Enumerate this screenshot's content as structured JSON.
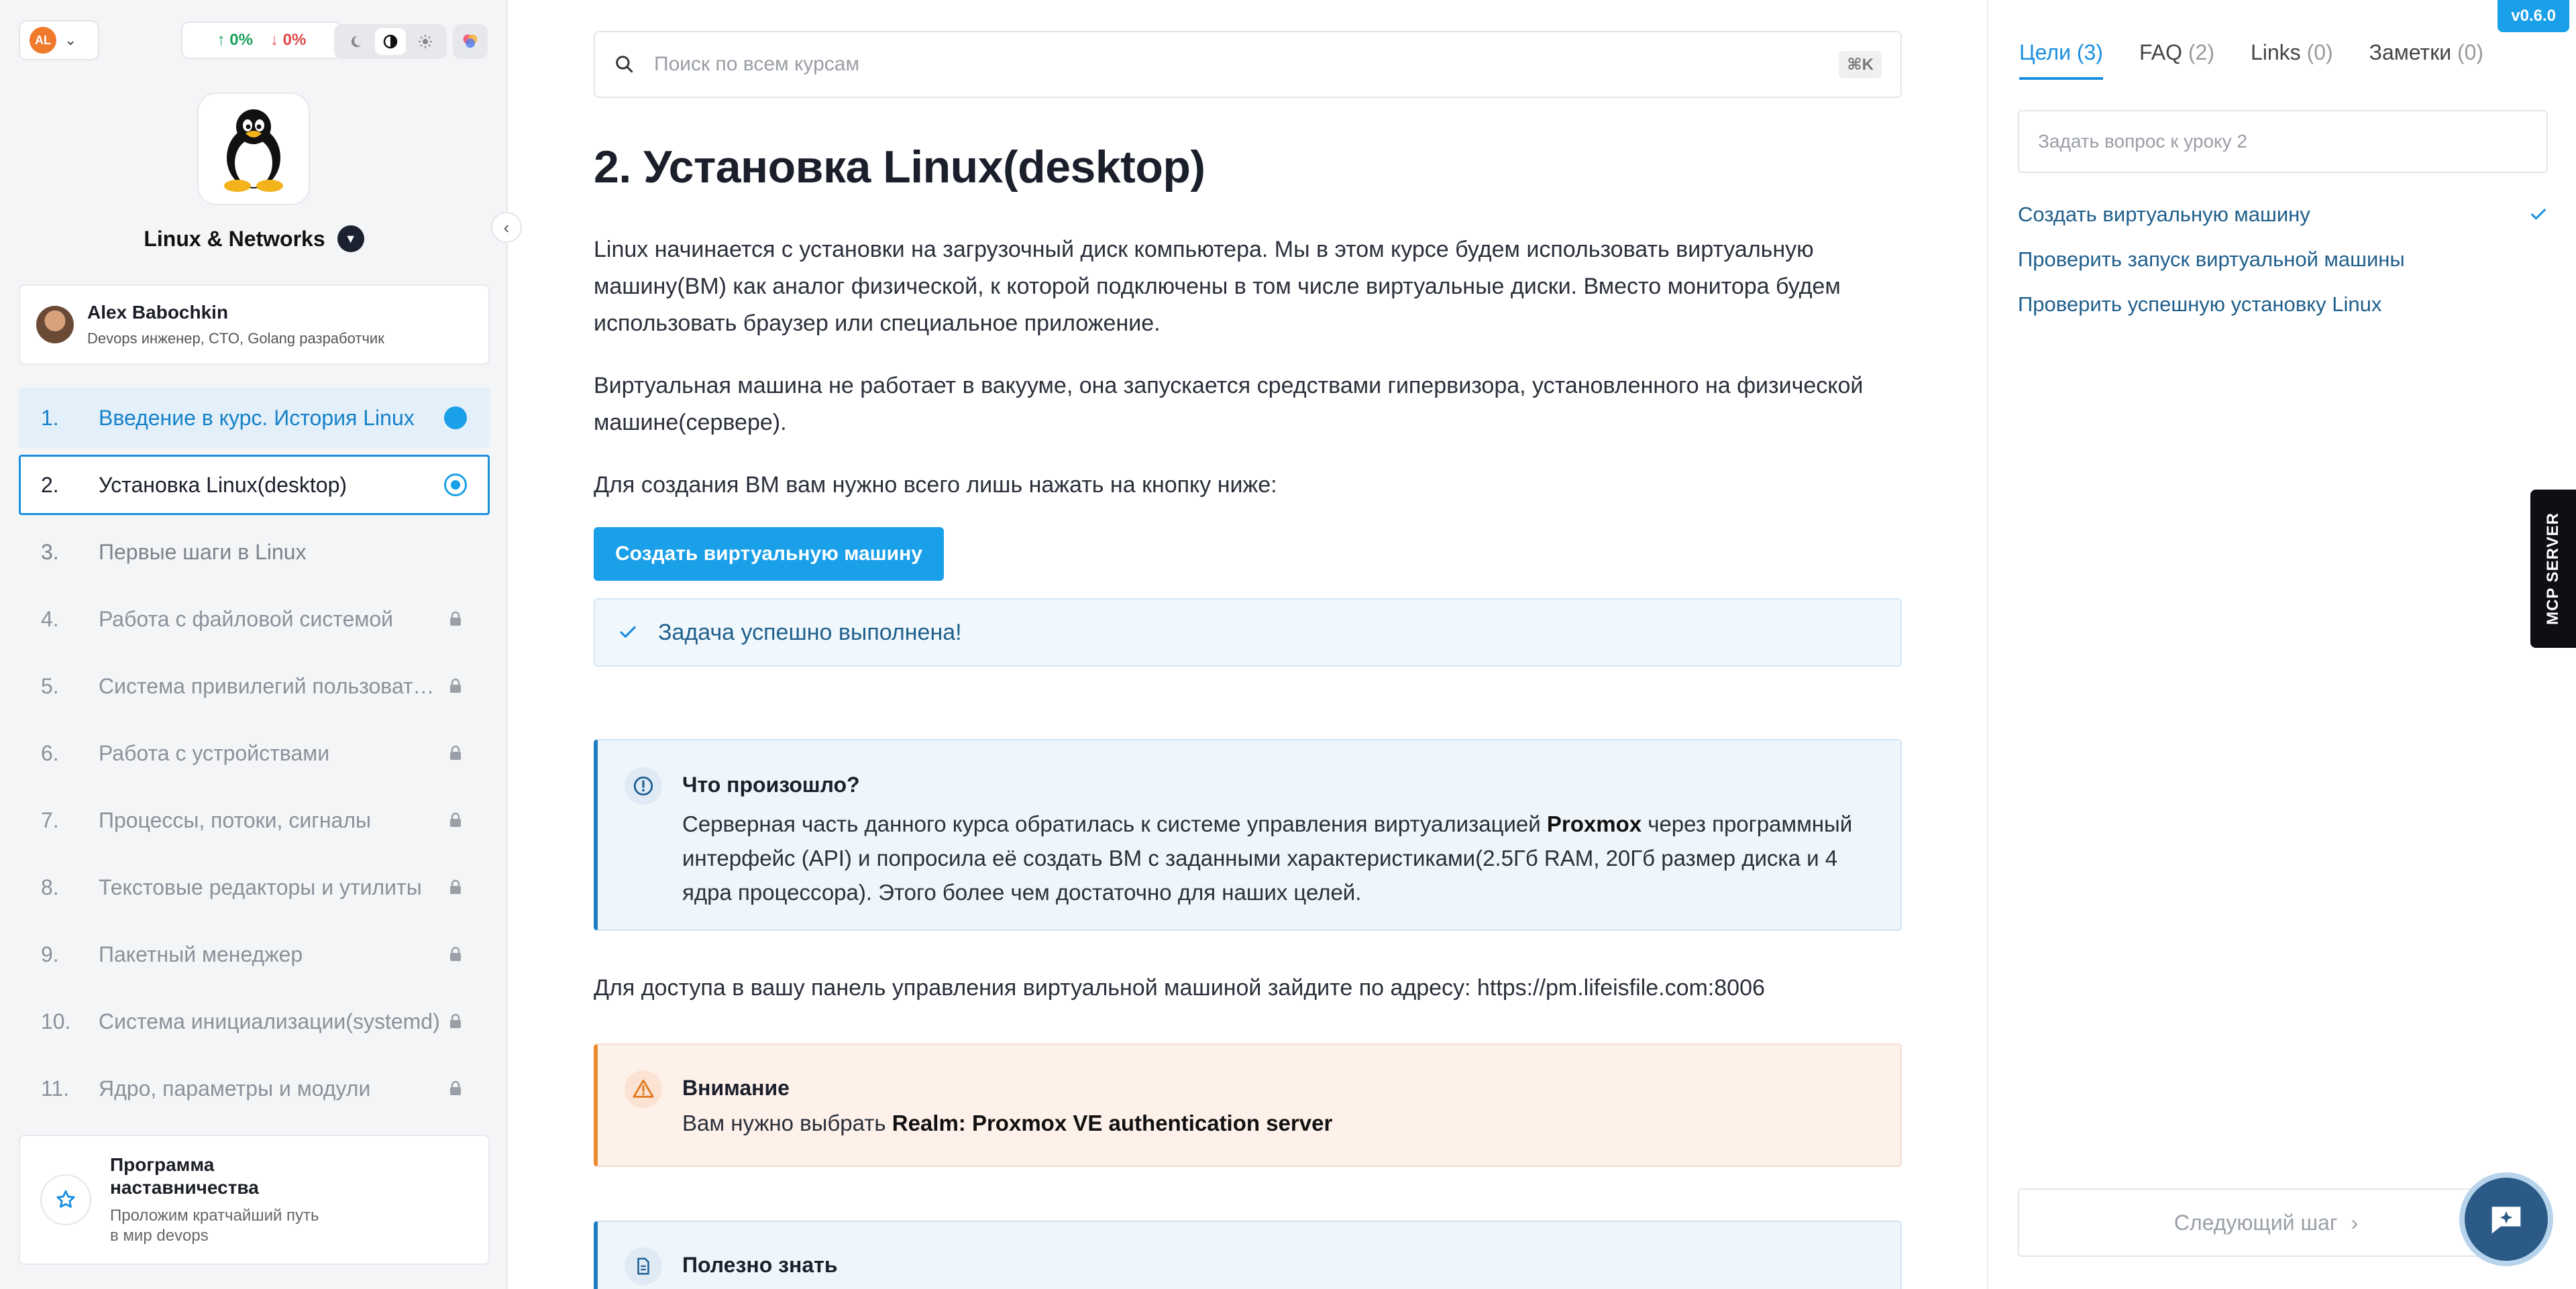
{
  "topbar": {
    "user_initials": "AL",
    "stat_up": "↑ 0%",
    "stat_down": "↓ 0%"
  },
  "course": {
    "title": "Linux & Networks"
  },
  "author": {
    "name": "Alex Babochkin",
    "role": "Devops инженер, CTO, Golang разработчик"
  },
  "lessons": [
    {
      "num": "1.",
      "title": "Введение в курс. История Linux",
      "status": "done"
    },
    {
      "num": "2.",
      "title": "Установка Linux(desktop)",
      "status": "current"
    },
    {
      "num": "3.",
      "title": "Первые шаги в Linux",
      "status": "open"
    },
    {
      "num": "4.",
      "title": "Работа с файловой системой",
      "status": "locked"
    },
    {
      "num": "5.",
      "title": "Система привилегий пользовате…",
      "status": "locked"
    },
    {
      "num": "6.",
      "title": "Работа с устройствами",
      "status": "locked"
    },
    {
      "num": "7.",
      "title": "Процессы, потоки, сигналы",
      "status": "locked"
    },
    {
      "num": "8.",
      "title": "Текстовые редакторы и утилиты",
      "status": "locked"
    },
    {
      "num": "9.",
      "title": "Пакетный менеджер",
      "status": "locked"
    },
    {
      "num": "10.",
      "title": "Система инициализации(systemd)",
      "status": "locked"
    },
    {
      "num": "11.",
      "title": "Ядро, параметры и модули",
      "status": "locked"
    }
  ],
  "mentor": {
    "title": "Программа наставничества",
    "subtitle": "Проложим кратчайший путь в мир devops"
  },
  "search": {
    "placeholder": "Поиск по всем курсам",
    "shortcut": "⌘K"
  },
  "content": {
    "heading": "2. Установка Linux(desktop)",
    "p1": "Linux начинается с установки на загрузочный диск компьютера. Мы в этом курсе будем использовать виртуальную машину(ВМ) как аналог физической, к которой подключены в том числе виртуальные диски. Вместо монитора будем использовать браузер или специальное приложение.",
    "p2": "Виртуальная машина не работает в вакууме, она запускается средствами гипервизора, установленного на физической машине(сервере).",
    "p3": "Для создания ВМ вам нужно всего лишь нажать на кнопку ниже:",
    "cta_label": "Создать виртуальную машину",
    "success_text": "Задача успешно выполнена!",
    "info_title": "Что произошло?",
    "info_body_1": "Серверная часть данного курса обратилась к системе управления виртуализацией ",
    "info_body_bold": "Proxmox",
    "info_body_2": " через программный интерфейс (API) и попросила её создать ВМ с заданными характеристиками(2.5Гб RAM, 20Гб размер диска и 4 ядра процессора). Этого более чем достаточно для наших целей.",
    "p4": "Для доступа в вашу панель управления виртуальной машиной зайдите по адресу: https://pm.lifeisfile.com:8006",
    "warn_title": "Внимание",
    "warn_body_1": "Вам нужно выбрать ",
    "warn_body_bold": "Realm: Proxmox VE authentication server",
    "tip_title": "Полезно знать"
  },
  "right_panel": {
    "version": "v0.6.0",
    "tabs": [
      {
        "label": "Цели",
        "count": "(3)"
      },
      {
        "label": "FAQ",
        "count": "(2)"
      },
      {
        "label": "Links",
        "count": "(0)"
      },
      {
        "label": "Заметки",
        "count": "(0)"
      }
    ],
    "ask_placeholder": "Задать вопрос к уроку 2",
    "goals": [
      {
        "text": "Создать виртуальную машину",
        "done": true
      },
      {
        "text": "Проверить запуск виртуальной машины",
        "done": false
      },
      {
        "text": "Проверить успешную установку Linux",
        "done": false
      }
    ],
    "next_label": "Следующий шаг",
    "mcp_label": "MCP SERVER"
  },
  "colors": {
    "accent": "#1a9fe9",
    "success_green": "#19a05a",
    "danger_red": "#e04848",
    "warning_orange": "#ec8a2e"
  }
}
